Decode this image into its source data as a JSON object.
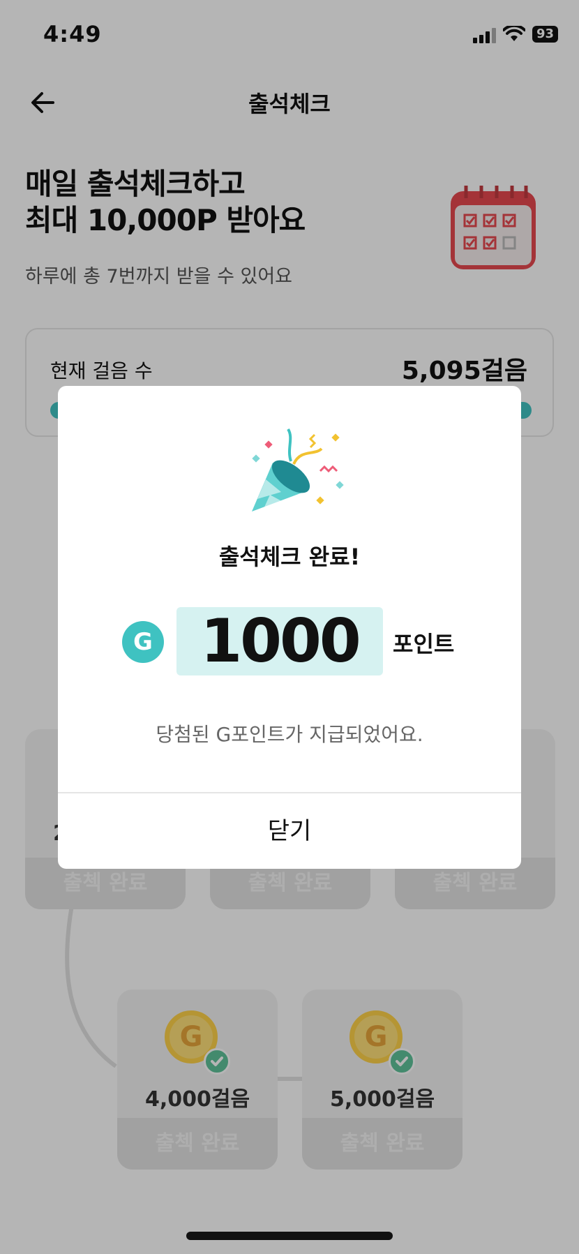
{
  "status_bar": {
    "time": "4:49",
    "battery": "93"
  },
  "header": {
    "title": "출석체크",
    "back_icon": "arrow-left-icon"
  },
  "hero": {
    "title_line1": "매일 출석체크하고",
    "title_line2": "최대 10,000P 받아요",
    "subtitle": "하루에 총 7번까지 받을 수 있어요"
  },
  "steps_card": {
    "label": "현재 걸음 수",
    "value": "5,095걸음"
  },
  "tiles": [
    {
      "value": "2,000걸음",
      "status": "출첵 완료"
    },
    {
      "value": "",
      "status": "출첵 완료"
    },
    {
      "value": "",
      "status": "출첵 완료"
    },
    {
      "value": "4,000걸음",
      "status": "출첵 완료"
    },
    {
      "value": "5,000걸음",
      "status": "출첵 완료"
    }
  ],
  "modal": {
    "title": "출석체크 완료!",
    "badge": "G",
    "points": "1000",
    "unit": "포인트",
    "message": "당첨된 G포인트가 지급되었어요.",
    "close_label": "닫기"
  },
  "colors": {
    "accent": "#3fc2c1",
    "points_bg": "#d6f2f1",
    "overlay": "rgba(0,0,0,0.29)"
  }
}
